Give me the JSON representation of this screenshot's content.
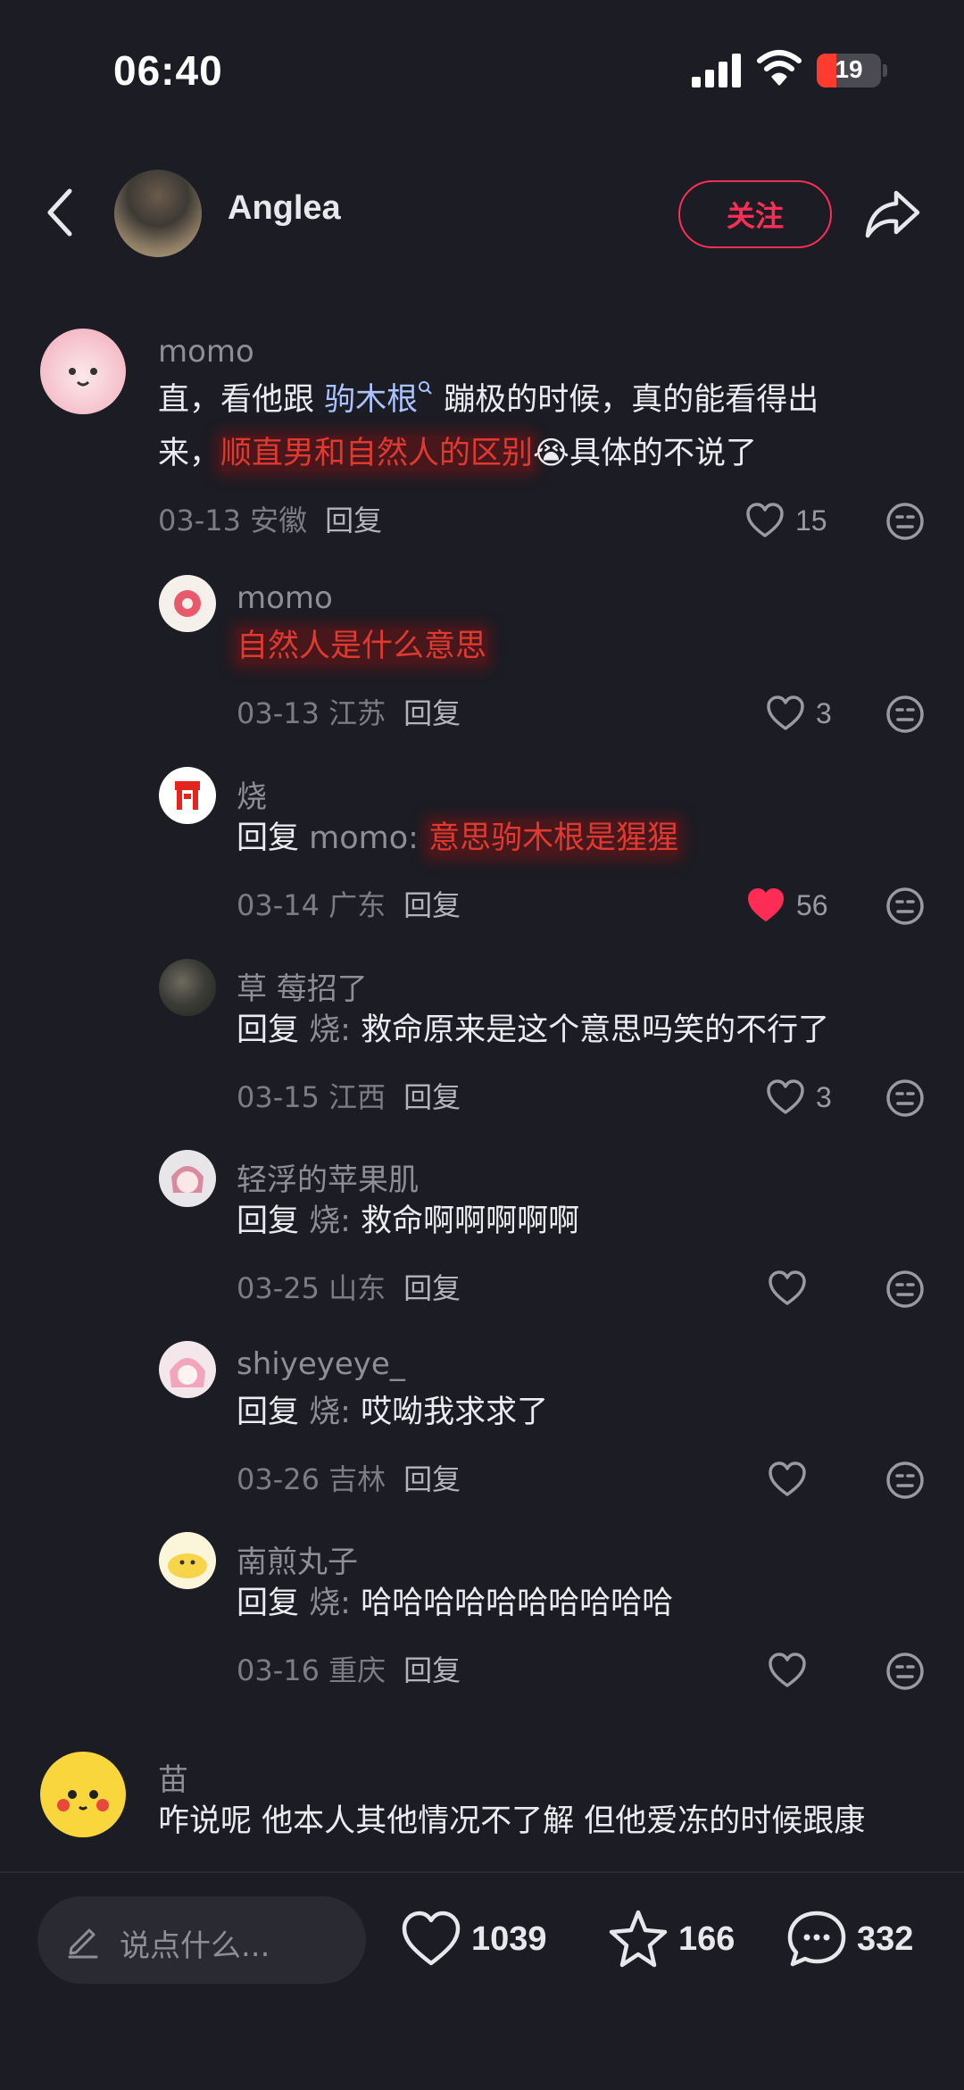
{
  "status_bar": {
    "time": "06:40",
    "battery": "19"
  },
  "header": {
    "author_name": "Anglea",
    "follow_label": "关注"
  },
  "comments": [
    {
      "user": "momo",
      "text_parts": [
        "直，看他跟 ",
        "驹木根",
        " 蹦极的时候，真的能看得出",
        "来，",
        "顺直男和自然人的区别",
        "😭",
        "具体的不说了"
      ],
      "date": "03-13 安徽",
      "reply_label": "回复",
      "likes": "15"
    },
    {
      "user": "momo",
      "text": "自然人是什么意思",
      "date": "03-13 江苏",
      "reply_label": "回复",
      "likes": "3"
    },
    {
      "user": "烧",
      "reply_prefix": "回复",
      "reply_target": "momo",
      "text": "意思驹木根是猩猩",
      "date": "03-14 广东",
      "reply_label": "回复",
      "likes": "56"
    },
    {
      "user": "草 莓招了",
      "reply_prefix": "回复",
      "reply_target": "烧",
      "text": "救命原来是这个意思吗笑的不行了",
      "date": "03-15 江西",
      "reply_label": "回复",
      "likes": "3"
    },
    {
      "user": "轻浮的苹果肌",
      "reply_prefix": "回复",
      "reply_target": "烧",
      "text": "救命啊啊啊啊啊",
      "date": "03-25 山东",
      "reply_label": "回复"
    },
    {
      "user": "shiyeyeye_",
      "reply_prefix": "回复",
      "reply_target": "烧",
      "text": "哎呦我求求了",
      "date": "03-26 吉林",
      "reply_label": "回复"
    },
    {
      "user": "南煎丸子",
      "reply_prefix": "回复",
      "reply_target": "烧",
      "text": "哈哈哈哈哈哈哈哈哈哈",
      "date": "03-16 重庆",
      "reply_label": "回复"
    },
    {
      "user": "苗",
      "text": "咋说呢 他本人其他情况不了解 但他爱冻的时候跟康"
    }
  ],
  "bottom_bar": {
    "input_placeholder": "说点什么...",
    "likes": "1039",
    "favorites": "166",
    "comments": "332"
  },
  "colors": {
    "accent": "#ff2d55",
    "highlight_text": "#e0392f",
    "liked_heart": "#ff2d55"
  }
}
